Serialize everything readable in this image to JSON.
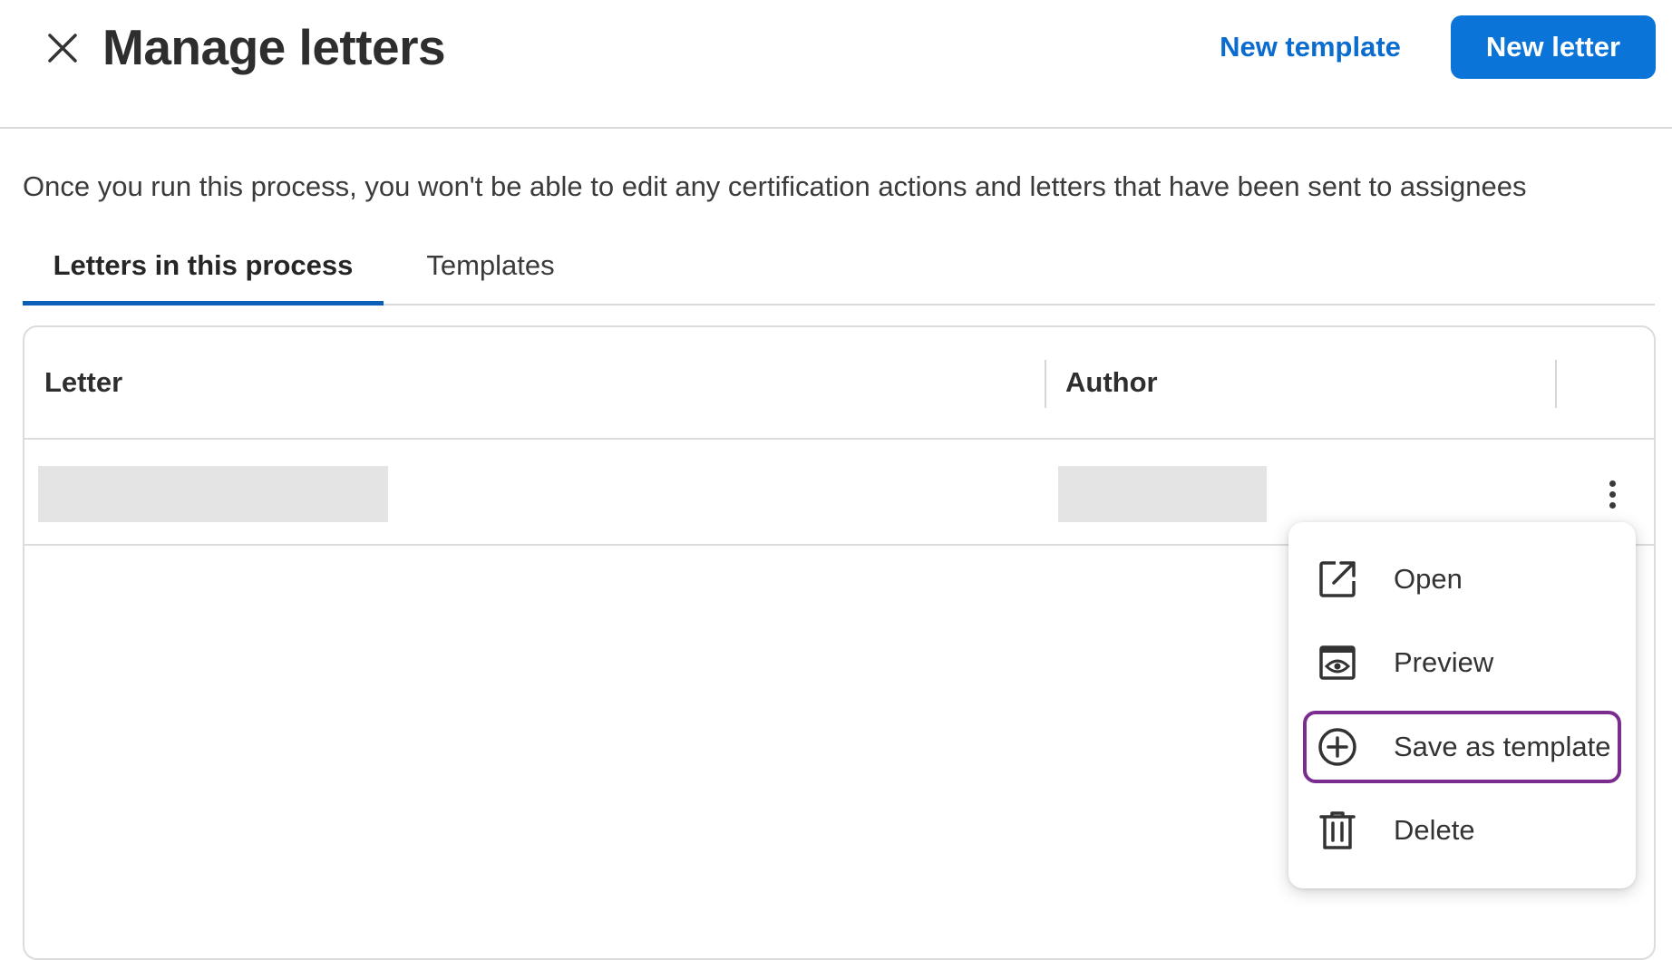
{
  "header": {
    "title": "Manage letters",
    "close_icon": "close-icon",
    "new_template_label": "New template",
    "new_letter_label": "New letter",
    "accent_color": "#0a74d8"
  },
  "notice": "Once you run this process, you won't be able to edit any certification actions and letters that have been sent to assignees",
  "tabs": [
    {
      "label": "Letters in this process",
      "active": true
    },
    {
      "label": "Templates",
      "active": false
    }
  ],
  "table": {
    "columns": [
      "Letter",
      "Author"
    ],
    "row_actions_icon": "more-vertical-icon"
  },
  "menu": {
    "items": [
      {
        "label": "Open",
        "icon": "open-external-icon"
      },
      {
        "label": "Preview",
        "icon": "preview-eye-icon"
      },
      {
        "label": "Save as template",
        "icon": "plus-circle-icon",
        "highlighted": true,
        "highlight_color": "#7a2d8f"
      },
      {
        "label": "Delete",
        "icon": "trash-icon"
      }
    ]
  }
}
